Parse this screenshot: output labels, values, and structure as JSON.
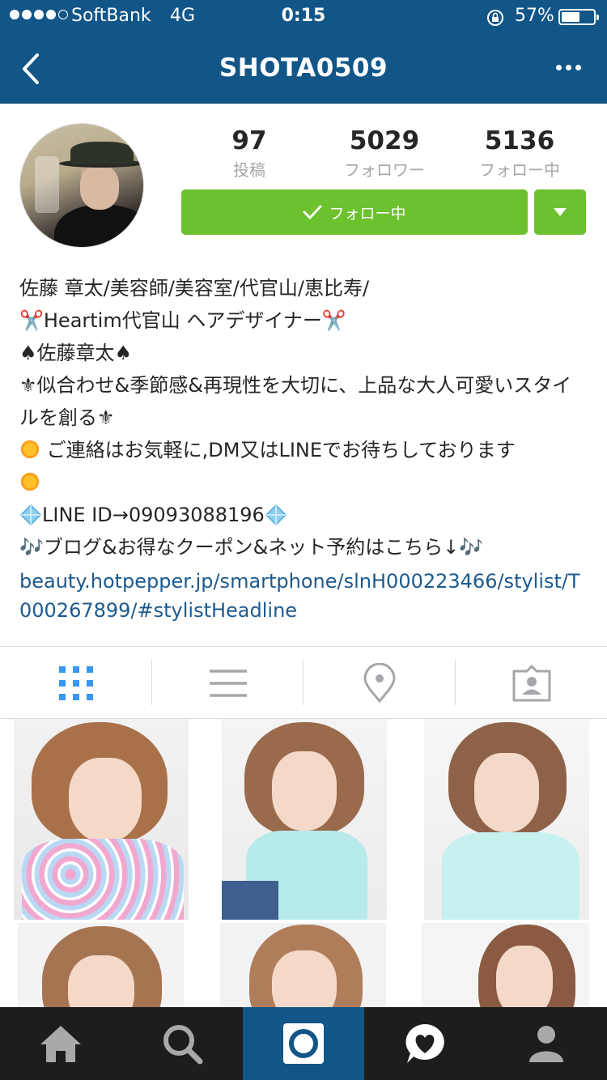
{
  "status_bar": {
    "carrier": "SoftBank",
    "network": "4G",
    "time": "0:15",
    "battery_percent_text": "57%",
    "battery_level": 0.57
  },
  "header": {
    "title": "SHOTA0509",
    "back_icon": "chevron-left-icon",
    "more_icon": "more-horizontal-icon"
  },
  "profile": {
    "stats": [
      {
        "value": "97",
        "label": "投稿"
      },
      {
        "value": "5029",
        "label": "フォロワー"
      },
      {
        "value": "5136",
        "label": "フォロー中"
      }
    ],
    "follow_button_label": "フォロー中",
    "bio_lines": [
      "佐藤 章太/美容師/美容室/代官山/恵比寿/",
      "✂️Heartim代官山 ヘアデザイナー✂️",
      "♠佐藤章太♠",
      "⚜似合わせ&季節感&再現性を大切に、上品な大人可愛いスタイルを創る⚜",
      "ご連絡はお気軽に,DM又はLINEでお待ちしております",
      "LINE ID→09093088196",
      "🎶ブログ&お得なクーポン&ネット予約はこちら↓🎶"
    ],
    "link": "beauty.hotpepper.jp/smartphone/slnH000223466/stylist/T000267899/#stylistHeadline"
  },
  "tabs": [
    {
      "name": "grid-view",
      "icon": "grid-icon",
      "active": true
    },
    {
      "name": "list-view",
      "icon": "list-icon",
      "active": false
    },
    {
      "name": "map-view",
      "icon": "location-pin-icon",
      "active": false
    },
    {
      "name": "tagged-view",
      "icon": "person-tag-icon",
      "active": false
    }
  ],
  "bottom_nav": [
    {
      "name": "home",
      "icon": "home-icon"
    },
    {
      "name": "search",
      "icon": "search-icon"
    },
    {
      "name": "camera",
      "icon": "camera-icon",
      "active": true
    },
    {
      "name": "activity",
      "icon": "heart-bubble-icon"
    },
    {
      "name": "profile",
      "icon": "person-icon"
    }
  ],
  "colors": {
    "header_bg": "#125688",
    "follow_green": "#6bc12e",
    "link_blue": "#1c5a8f",
    "nav_bg": "#1d1d1d",
    "active_tab_blue": "#3897f0"
  }
}
